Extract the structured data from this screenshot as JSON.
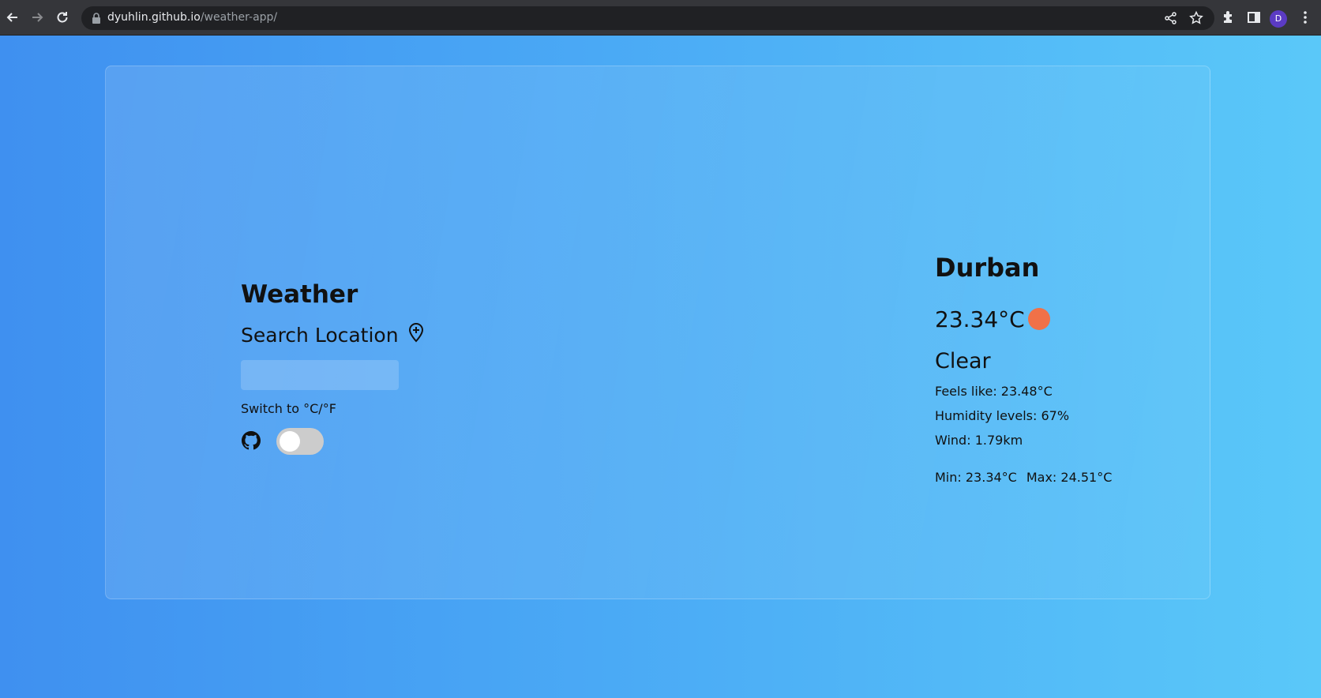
{
  "browser": {
    "url_host": "dyuhlin.github.io",
    "url_path": "/weather-app/",
    "profile_initial": "D",
    "icons": [
      "back-icon",
      "forward-icon",
      "reload-icon",
      "lock-icon",
      "share-icon",
      "star-icon",
      "extensions-icon",
      "side-panel-icon",
      "menu-icon"
    ]
  },
  "app": {
    "title": "Weather",
    "search_label": "Search Location",
    "search_value": "",
    "switch_label": "Switch to °C/°F",
    "unit_toggle_on": false
  },
  "weather": {
    "city": "Durban",
    "temperature": "23.34°C",
    "condition": "Clear",
    "feels_like": "Feels like: 23.48°C",
    "humidity": "Humidity levels: 67%",
    "wind": "Wind: 1.79km",
    "min": "Min: 23.34°C",
    "max": "Max: 24.51°C",
    "icon": "sun-icon"
  },
  "colors": {
    "gradient_start": "#3f90f0",
    "gradient_end": "#5ac8f9",
    "sun": "#f07148",
    "toggle_off": "#cccccc"
  }
}
